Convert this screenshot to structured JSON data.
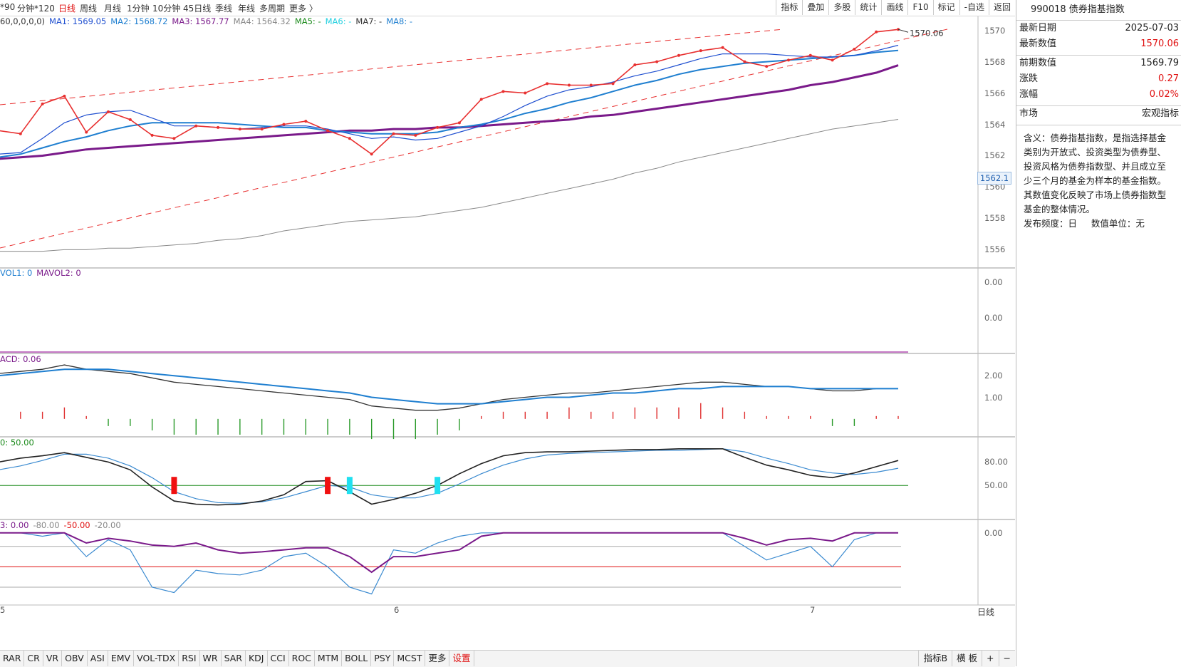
{
  "toolbar": {
    "periods": [
      "*90",
      "分钟*120",
      "日线",
      "周线",
      "月线",
      "1分钟",
      "10分钟",
      "45日线",
      "季线",
      "年线",
      "多周期",
      "更多 〉"
    ],
    "active_period": "日线",
    "tools": [
      "指标",
      "叠加",
      "多股",
      "统计",
      "画线",
      "F10",
      "标记",
      "-自选",
      "返回"
    ]
  },
  "main_pane": {
    "legend": [
      {
        "text": "60,0,0,0,0)",
        "color": "#333333"
      },
      {
        "text": "MA1: 1569.05",
        "color": "#1f4fd0"
      },
      {
        "text": "MA2: 1568.72",
        "color": "#1f7fd0"
      },
      {
        "text": "MA3: 1567.77",
        "color": "#7a1a8a"
      },
      {
        "text": "MA4: 1564.32",
        "color": "#888888"
      },
      {
        "text": "MA5: -",
        "color": "#1a8a1a"
      },
      {
        "text": "MA6: -",
        "color": "#22d0e0"
      },
      {
        "text": "MA7: -",
        "color": "#333333"
      },
      {
        "text": "MA8: -",
        "color": "#1f7fd0"
      }
    ],
    "y_ticks": [
      "1570",
      "1568",
      "1566",
      "1564",
      "1562",
      "1560",
      "1558",
      "1556"
    ],
    "current_price_tag": "1562.1",
    "last_value_label": "1570.06",
    "chart_data": {
      "type": "line",
      "series": [
        {
          "name": "MA1",
          "color": "#1f4fd0"
        },
        {
          "name": "MA2",
          "color": "#1f7fd0"
        },
        {
          "name": "MA3",
          "color": "#7a1a8a"
        },
        {
          "name": "MA4",
          "color": "#888888"
        }
      ],
      "close_values": [
        1563.6,
        1563.4,
        1565.3,
        1565.8,
        1563.5,
        1564.8,
        1564.3,
        1563.3,
        1563.1,
        1563.9,
        1563.8,
        1563.7,
        1563.7,
        1564.0,
        1564.2,
        1563.6,
        1563.1,
        1562.1,
        1563.4,
        1563.3,
        1563.8,
        1564.1,
        1565.6,
        1566.1,
        1566.0,
        1566.6,
        1566.5,
        1566.5,
        1566.6,
        1567.8,
        1568.0,
        1568.4,
        1568.7,
        1568.9,
        1568.0,
        1567.7,
        1568.1,
        1568.4,
        1568.1,
        1568.8,
        1569.9,
        1570.06
      ],
      "ma_values": {
        "MA1": [
          1562.1,
          1562.2,
          1563.1,
          1564.1,
          1564.6,
          1564.8,
          1564.9,
          1564.4,
          1563.9,
          1563.9,
          1563.8,
          1563.7,
          1563.8,
          1563.9,
          1563.9,
          1563.7,
          1563.4,
          1563.1,
          1563.2,
          1563.0,
          1563.1,
          1563.5,
          1563.9,
          1564.5,
          1565.2,
          1565.8,
          1566.2,
          1566.4,
          1566.7,
          1567.1,
          1567.4,
          1567.8,
          1568.2,
          1568.5,
          1568.5,
          1568.5,
          1568.4,
          1568.3,
          1568.3,
          1568.4,
          1568.7,
          1569.05
        ],
        "MA2": [
          1561.9,
          1562.1,
          1562.5,
          1562.9,
          1563.2,
          1563.6,
          1563.9,
          1564.1,
          1564.1,
          1564.1,
          1564.1,
          1564.0,
          1563.9,
          1563.8,
          1563.8,
          1563.6,
          1563.5,
          1563.4,
          1563.4,
          1563.4,
          1563.5,
          1563.8,
          1564.0,
          1564.3,
          1564.7,
          1565.0,
          1565.4,
          1565.7,
          1566.1,
          1566.5,
          1566.8,
          1567.2,
          1567.5,
          1567.7,
          1567.9,
          1568.0,
          1568.1,
          1568.2,
          1568.3,
          1568.4,
          1568.6,
          1568.72
        ],
        "MA3": [
          1561.8,
          1561.9,
          1562.0,
          1562.2,
          1562.4,
          1562.5,
          1562.6,
          1562.7,
          1562.8,
          1562.9,
          1563.0,
          1563.1,
          1563.2,
          1563.3,
          1563.4,
          1563.5,
          1563.6,
          1563.6,
          1563.7,
          1563.7,
          1563.8,
          1563.8,
          1563.9,
          1564.0,
          1564.1,
          1564.2,
          1564.3,
          1564.5,
          1564.6,
          1564.8,
          1565.0,
          1565.2,
          1565.4,
          1565.6,
          1565.8,
          1566.0,
          1566.2,
          1566.5,
          1566.7,
          1567.0,
          1567.3,
          1567.77
        ],
        "MA4": [
          1555.9,
          1555.9,
          1555.9,
          1556.0,
          1556.0,
          1556.1,
          1556.1,
          1556.2,
          1556.3,
          1556.4,
          1556.6,
          1556.7,
          1556.9,
          1557.2,
          1557.4,
          1557.6,
          1557.8,
          1557.9,
          1558.0,
          1558.1,
          1558.3,
          1558.5,
          1558.7,
          1559.0,
          1559.3,
          1559.6,
          1559.9,
          1560.2,
          1560.5,
          1560.9,
          1561.2,
          1561.6,
          1561.9,
          1562.2,
          1562.5,
          1562.8,
          1563.1,
          1563.4,
          1563.7,
          1563.9,
          1564.1,
          1564.32
        ]
      },
      "ylim": [
        1555.5,
        1570.5
      ]
    }
  },
  "vol_pane": {
    "legend": [
      {
        "text": "VOL1: 0",
        "color": "#1f7fd0"
      },
      {
        "text": "MAVOL2: 0",
        "color": "#7a1a8a"
      }
    ],
    "y_ticks": [
      "0.00",
      "0.00"
    ]
  },
  "macd_pane": {
    "legend": [
      {
        "text": "ACD: 0.06",
        "color": "#7a1a8a"
      }
    ],
    "y_ticks": [
      "2.00",
      "1.00"
    ],
    "chart_data": {
      "type": "line",
      "dif": [
        2.1,
        2.2,
        2.3,
        2.5,
        2.3,
        2.2,
        2.1,
        1.9,
        1.7,
        1.6,
        1.5,
        1.4,
        1.3,
        1.2,
        1.1,
        1.0,
        0.9,
        0.6,
        0.5,
        0.4,
        0.4,
        0.5,
        0.7,
        0.9,
        1.0,
        1.1,
        1.2,
        1.2,
        1.3,
        1.4,
        1.5,
        1.6,
        1.7,
        1.7,
        1.6,
        1.5,
        1.5,
        1.4,
        1.3,
        1.3,
        1.4,
        1.4
      ],
      "dea": [
        2.0,
        2.1,
        2.2,
        2.3,
        2.3,
        2.3,
        2.2,
        2.1,
        2.0,
        1.9,
        1.8,
        1.7,
        1.6,
        1.5,
        1.4,
        1.3,
        1.2,
        1.0,
        0.9,
        0.8,
        0.7,
        0.7,
        0.7,
        0.8,
        0.9,
        1.0,
        1.0,
        1.1,
        1.2,
        1.2,
        1.3,
        1.4,
        1.4,
        1.5,
        1.5,
        1.5,
        1.5,
        1.4,
        1.4,
        1.4,
        1.4,
        1.4
      ],
      "ylim": [
        -0.5,
        2.8
      ]
    }
  },
  "kdj_pane": {
    "legend": [
      {
        "text": "0: 50.00",
        "color": "#1a8a1a"
      }
    ],
    "y_ticks": [
      "80.00",
      "50.00"
    ],
    "chart_data": {
      "type": "line",
      "k": [
        80,
        85,
        88,
        92,
        86,
        80,
        70,
        48,
        30,
        26,
        25,
        26,
        30,
        38,
        55,
        56,
        42,
        26,
        32,
        40,
        50,
        65,
        78,
        88,
        92,
        93,
        93,
        94,
        95,
        96,
        96,
        97,
        97,
        97,
        86,
        76,
        70,
        63,
        60,
        66,
        74,
        82
      ],
      "d": [
        70,
        75,
        82,
        90,
        90,
        85,
        75,
        60,
        42,
        33,
        28,
        27,
        29,
        34,
        42,
        50,
        48,
        38,
        34,
        34,
        40,
        52,
        65,
        76,
        84,
        89,
        91,
        92,
        93,
        94,
        95,
        95,
        96,
        97,
        93,
        85,
        78,
        70,
        66,
        64,
        67,
        72
      ],
      "buy_markers": [
        16,
        20
      ],
      "sell_markers": [
        8,
        15
      ],
      "ylim": [
        10,
        105
      ]
    }
  },
  "wr_pane": {
    "legend": [
      {
        "text": "3: 0.00",
        "color": "#7a1a8a"
      },
      {
        "text": "-80.00",
        "color": "#888888"
      },
      {
        "text": "-50.00",
        "color": "#e01010"
      },
      {
        "text": "-20.00",
        "color": "#888888"
      }
    ],
    "y_ticks": [
      "0.00"
    ],
    "chart_data": {
      "type": "line",
      "wr1": [
        0,
        0,
        -5,
        0,
        -35,
        -10,
        -25,
        -80,
        -88,
        -55,
        -60,
        -62,
        -55,
        -35,
        -30,
        -50,
        -80,
        -90,
        -25,
        -30,
        -15,
        -5,
        0,
        0,
        0,
        0,
        0,
        0,
        0,
        0,
        0,
        0,
        0,
        0,
        -20,
        -40,
        -30,
        -20,
        -50,
        -10,
        0,
        0
      ],
      "wr2": [
        0,
        0,
        0,
        0,
        -15,
        -8,
        -12,
        -18,
        -20,
        -15,
        -25,
        -30,
        -28,
        -25,
        -22,
        -22,
        -35,
        -58,
        -35,
        -35,
        -30,
        -25,
        -5,
        0,
        0,
        0,
        0,
        0,
        0,
        0,
        0,
        0,
        0,
        0,
        -8,
        -18,
        -10,
        -8,
        -12,
        0,
        0,
        0
      ],
      "ylim": [
        -100,
        5
      ]
    }
  },
  "date_axis": [
    "5",
    "6",
    "7"
  ],
  "period_label": "日线",
  "bottom_indicators": [
    "RAR",
    "CR",
    "VR",
    "OBV",
    "ASI",
    "EMV",
    "VOL-TDX",
    "RSI",
    "WR",
    "SAR",
    "KDJ",
    "CCI",
    "ROC",
    "MTM",
    "BOLL",
    "PSY",
    "MCST",
    "更多",
    "设置"
  ],
  "bottom_right": [
    "指标B",
    "横 板",
    "+",
    "−"
  ],
  "right_panel": {
    "title": "990018 债券指基指数",
    "rows": [
      {
        "label": "最新日期",
        "value": "2025-07-03",
        "red": false
      },
      {
        "label": "最新数值",
        "value": "1570.06",
        "red": true
      },
      {
        "label": "前期数值",
        "value": "1569.79",
        "red": false
      },
      {
        "label": "涨跌",
        "value": "0.27",
        "red": true
      },
      {
        "label": "涨幅",
        "value": "0.02%",
        "red": true
      },
      {
        "label": "市场",
        "value": "宏观指标",
        "red": false
      }
    ],
    "description": "含义：债券指基指数，是指选择基金类别为开放式、投资类型为债券型、投资风格为债券指数型、并且成立至少三个月的基金为样本的基金指数。其数值变化反映了市场上债券指数型基金的整体情况。",
    "frequency": "发布频度：日     数值单位：无"
  },
  "colors": {
    "close": "#e83030",
    "trend": "#e83030",
    "grid": "#e6e6e6"
  }
}
